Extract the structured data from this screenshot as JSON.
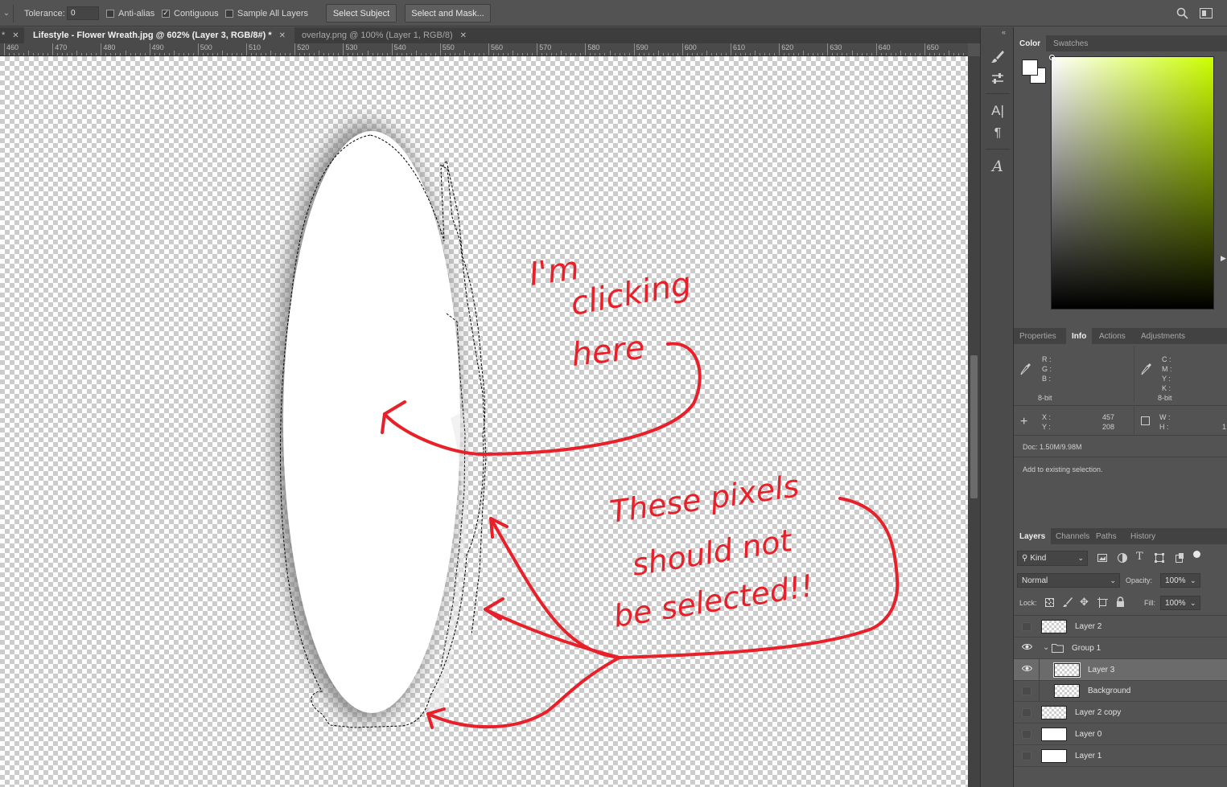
{
  "options_bar": {
    "tolerance_label": "Tolerance:",
    "tolerance_value": "0",
    "anti_alias": {
      "label": "Anti-alias",
      "checked": false
    },
    "contiguous": {
      "label": "Contiguous",
      "checked": true
    },
    "sample_all_layers": {
      "label": "Sample All Layers",
      "checked": false
    },
    "select_subject": "Select Subject",
    "select_and_mask": "Select and Mask..."
  },
  "tabs": {
    "active": {
      "title": "Lifestyle - Flower Wreath.jpg @ 602% (Layer 3, RGB/8#) *"
    },
    "inactive": {
      "title": "overlay.png @ 100% (Layer 1, RGB/8)"
    }
  },
  "ruler": {
    "ticks": [
      "460",
      "470",
      "480",
      "490",
      "500",
      "510",
      "520",
      "530",
      "540",
      "550",
      "560",
      "570",
      "580",
      "590",
      "600",
      "610",
      "620",
      "630",
      "640",
      "650"
    ]
  },
  "annotations": {
    "clicking_line1": "I'm",
    "clicking_line2": "clicking",
    "clicking_line3": "here",
    "pixels_line1": "These pixels",
    "pixels_line2": "should not",
    "pixels_line3": "be selected!!",
    "color": "#e8202a"
  },
  "color_panel": {
    "tabs": [
      "Color",
      "Swatches"
    ],
    "active_tab": "Color",
    "hue_color": "#ccff00"
  },
  "info_panel": {
    "tabs": [
      "Properties",
      "Info",
      "Actions",
      "Adjustments"
    ],
    "active_tab": "Info",
    "rgb_labels": {
      "r": "R :",
      "g": "G :",
      "b": "B :"
    },
    "cmyk_labels": {
      "c": "C :",
      "m": "M :",
      "y": "Y :",
      "k": "K :"
    },
    "bit_depth_left": "8-bit",
    "bit_depth_right": "8-bit",
    "x_label": "X :",
    "y_label": "Y :",
    "x_value": "457",
    "y_value": "208",
    "w_label": "W :",
    "h_label": "H :",
    "w_value": "",
    "h_value": "1",
    "doc": "Doc: 1.50M/9.98M",
    "status": "Add to existing selection."
  },
  "layers_panel": {
    "tabs": [
      "Layers",
      "Channels",
      "Paths",
      "History"
    ],
    "active_tab": "Layers",
    "filter_kind": "Kind",
    "blend_mode": "Normal",
    "opacity_label": "Opacity:",
    "opacity_value": "100%",
    "lock_label": "Lock:",
    "fill_label": "Fill:",
    "fill_value": "100%",
    "layers": [
      {
        "name": "Layer 2",
        "visible": false,
        "thumb": "checker",
        "indent": 0,
        "selected": false
      },
      {
        "name": "Group 1",
        "visible": true,
        "thumb": "folder",
        "indent": 0,
        "selected": false
      },
      {
        "name": "Layer 3",
        "visible": true,
        "thumb": "checker",
        "indent": 1,
        "selected": true
      },
      {
        "name": "Background",
        "visible": false,
        "thumb": "checker",
        "indent": 1,
        "selected": false
      },
      {
        "name": "Layer 2 copy",
        "visible": false,
        "thumb": "checker",
        "indent": 0,
        "selected": false
      },
      {
        "name": "Layer 0",
        "visible": false,
        "thumb": "white",
        "indent": 0,
        "selected": false
      },
      {
        "name": "Layer 1",
        "visible": false,
        "thumb": "white",
        "indent": 0,
        "selected": false
      }
    ]
  }
}
